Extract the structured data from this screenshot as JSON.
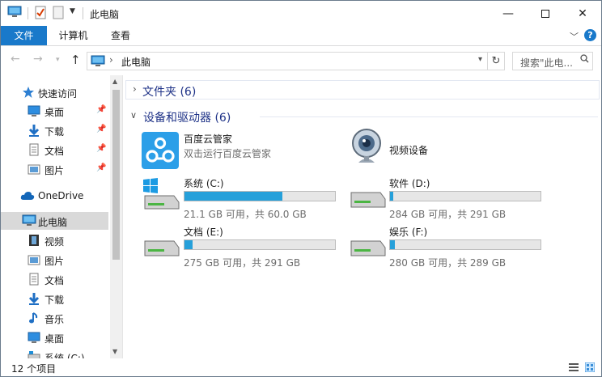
{
  "window": {
    "title": "此电脑"
  },
  "ribbon": {
    "tabs": [
      {
        "label": "文件",
        "active": true
      },
      {
        "label": "计算机",
        "active": false
      },
      {
        "label": "查看",
        "active": false
      }
    ]
  },
  "address": {
    "path": "此电脑",
    "search_placeholder": "搜索\"此电..."
  },
  "nav": {
    "quick_access": "快速访问",
    "quick_items": [
      "桌面",
      "下载",
      "文档",
      "图片"
    ],
    "onedrive": "OneDrive",
    "this_pc": "此电脑",
    "pc_items": [
      "视频",
      "图片",
      "文档",
      "下载",
      "音乐",
      "桌面",
      "系统 (C:)"
    ]
  },
  "content": {
    "folders_group": "文件夹 (6)",
    "devices_group": "设备和驱动器 (6)",
    "apps": [
      {
        "name": "百度云管家",
        "sub": "双击运行百度云管家"
      },
      {
        "name": "视频设备",
        "sub": ""
      }
    ],
    "drives": [
      {
        "name": "系统 (C:)",
        "sub": "21.1 GB 可用，共 60.0 GB",
        "used_fraction": 0.648
      },
      {
        "name": "软件 (D:)",
        "sub": "284 GB 可用，共 291 GB",
        "used_fraction": 0.024
      },
      {
        "name": "文档 (E:)",
        "sub": "275 GB 可用，共 291 GB",
        "used_fraction": 0.055
      },
      {
        "name": "娱乐 (F:)",
        "sub": "280 GB 可用，共 289 GB",
        "used_fraction": 0.031
      }
    ]
  },
  "status": {
    "item_count": "12 个项目"
  },
  "colors": {
    "accent": "#1979ca",
    "bar_fill": "#26a0da",
    "group_heading": "#1e3287"
  }
}
